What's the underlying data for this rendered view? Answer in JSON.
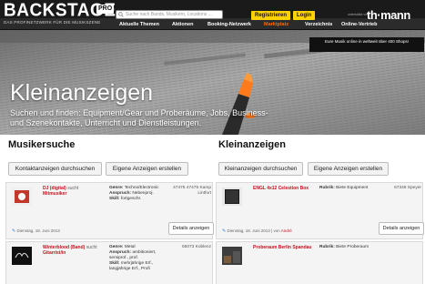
{
  "header": {
    "logo_text": "BACKSTAGE",
    "logo_badge": "PRO",
    "tagline": "DAS PROFINETZWERK FÜR DIE MUSIKSZENE",
    "search_placeholder": "Suche nach Bands, Musikern, Locations ...",
    "register_label": "Registrieren",
    "login_label": "Login",
    "sponsor_small": "unterstützt von",
    "sponsor_logo": "th·mann",
    "nav": [
      "Aktuelle Themen",
      "Aktionen",
      "Booking-Netzwerk",
      "Marktplatz",
      "Verzeichnis",
      "Online-Vertrieb"
    ],
    "nav_active_index": 3,
    "promo": "Eure Musik online in weltweit über 400 Shops!"
  },
  "hero": {
    "title": "Kleinanzeigen",
    "text": "Suchen und finden: Equipment/Gear und Proberäume, Jobs, Business- und Szenekontakte, Unterricht und Dienstleistungen."
  },
  "musikersuche": {
    "title": "Musikersuche",
    "btn_browse": "Kontaktanzeigen durchsuchen",
    "btn_create": "Eigene Anzeigen erstellen",
    "ads": [
      {
        "name": "DJ (digital)",
        "suchte": "sucht",
        "wanted": "Mitmusiker",
        "genre_label": "Genre:",
        "genre": "Techno/Electronic",
        "anspruch_label": "Anspruch:",
        "anspruch": "Nebenproj.",
        "skill_label": "Skill:",
        "skill": "fortgeschr.",
        "location": "47475 47475 Kamp Lintfort",
        "date": "Dienstag, 18. Juni 2013",
        "details_label": "Details anzeigen"
      },
      {
        "name": "Winterblood (Band)",
        "suchte": "sucht",
        "wanted": "Gitarrist/in",
        "genre_label": "Genre:",
        "genre": "Metal",
        "anspruch_label": "Anspruch:",
        "anspruch": "ambitioniert, semiprof., prof.",
        "skill_label": "Skill:",
        "skill": "mehrjährige Erf., langjährige Erf., Profi",
        "location": "56073 Koblenz"
      }
    ]
  },
  "kleinanzeigen": {
    "title": "Kleinanzeigen",
    "btn_browse": "Kleinanzeigen durchsuchen",
    "btn_create": "Eigene Anzeigen erstellen",
    "ads": [
      {
        "title": "ENGL 4x12 Celestion Box",
        "rubrik_label": "Rubrik:",
        "rubrik": "Biete Equipment",
        "location": "67346 Speyer",
        "date": "Dienstag, 18. Juni 2013",
        "by_prefix": "von",
        "by": "André",
        "details_label": "Details anzeigen"
      },
      {
        "title": "Proberaum Berlin Spandau",
        "rubrik_label": "Rubrik:",
        "rubrik": "Biete Proberaum"
      }
    ]
  },
  "colors": {
    "accent_yellow": "#ffd200",
    "accent_orange": "#ff6a00",
    "link_red": "#c4121f",
    "header_dark": "#1a1a1a"
  }
}
